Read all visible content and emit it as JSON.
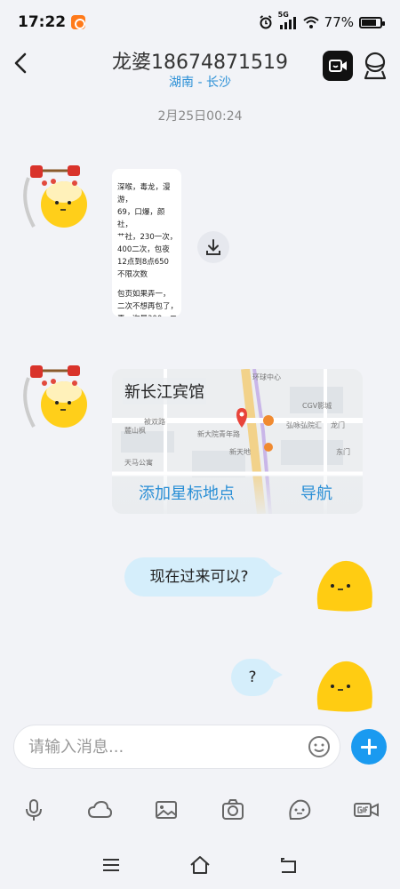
{
  "status_bar": {
    "time": "17:22",
    "network": "5G",
    "battery": "77%",
    "icons": [
      "app-notification-icon",
      "alarm-icon",
      "signal-icon",
      "wifi-icon",
      "battery-icon"
    ]
  },
  "header": {
    "title": "龙婆18674871519",
    "subtitle": "湖南 - 长沙",
    "icons": [
      "back-icon",
      "video-call-icon",
      "profile-icon"
    ]
  },
  "chat": {
    "timestamp": "2月25日00:24",
    "image_message": {
      "text_block_1": "深喉，毒龙，漫游，\n69，口爆，颜社，\n艹社，230一次，\n400二次，包夜\n12点到8点650\n不限次数",
      "text_block_2": "包页如果弄一，\n二次不想再包了，\n弄一次是300，二\n次是500"
    },
    "location_message": {
      "name": "新长江宾馆",
      "action_star": "添加星标地点",
      "action_navigate": "导航",
      "map_labels": [
        "新大院青年路",
        "新天地",
        "天马公寓",
        "CGV影城",
        "环球中心",
        "弘咏弘院汇",
        "龙门",
        "被双路",
        "麓山枫",
        "东门"
      ]
    },
    "outgoing_messages": [
      "现在过来可以?",
      "?"
    ]
  },
  "composer": {
    "placeholder": "请输入消息..."
  },
  "toolbar": {
    "icons": [
      "microphone-icon",
      "cloud-icon",
      "image-icon",
      "camera-icon",
      "emoji-sticker-icon",
      "gif-icon"
    ]
  },
  "navbar": {
    "icons": [
      "menu-icon",
      "home-icon",
      "back-nav-icon"
    ]
  },
  "colors": {
    "accent": "#1a9af0",
    "link": "#2a8fd6",
    "bubble_out": "#d5eefb",
    "background": "#f2f3f7"
  }
}
